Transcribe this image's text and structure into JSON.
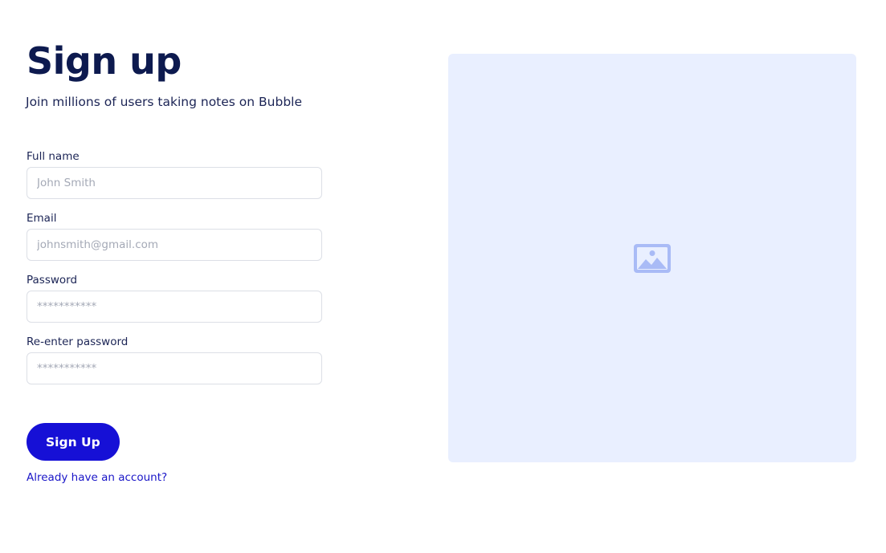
{
  "header": {
    "title": "Sign up",
    "subtitle": "Join millions of users taking notes on Bubble"
  },
  "form": {
    "fields": [
      {
        "label": "Full name",
        "placeholder": "John Smith",
        "type": "text"
      },
      {
        "label": "Email",
        "placeholder": "johnsmith@gmail.com",
        "type": "email"
      },
      {
        "label": "Password",
        "placeholder": "***********",
        "type": "text"
      },
      {
        "label": "Re-enter password",
        "placeholder": "***********",
        "type": "text"
      }
    ],
    "submit_label": "Sign Up",
    "login_link": "Already have an account?"
  },
  "image_panel": {
    "icon": "image-placeholder-icon"
  },
  "colors": {
    "primary": "#1610d6",
    "heading": "#0d1a4f",
    "panel_bg": "#e9efff",
    "icon": "#a9bbf6"
  }
}
